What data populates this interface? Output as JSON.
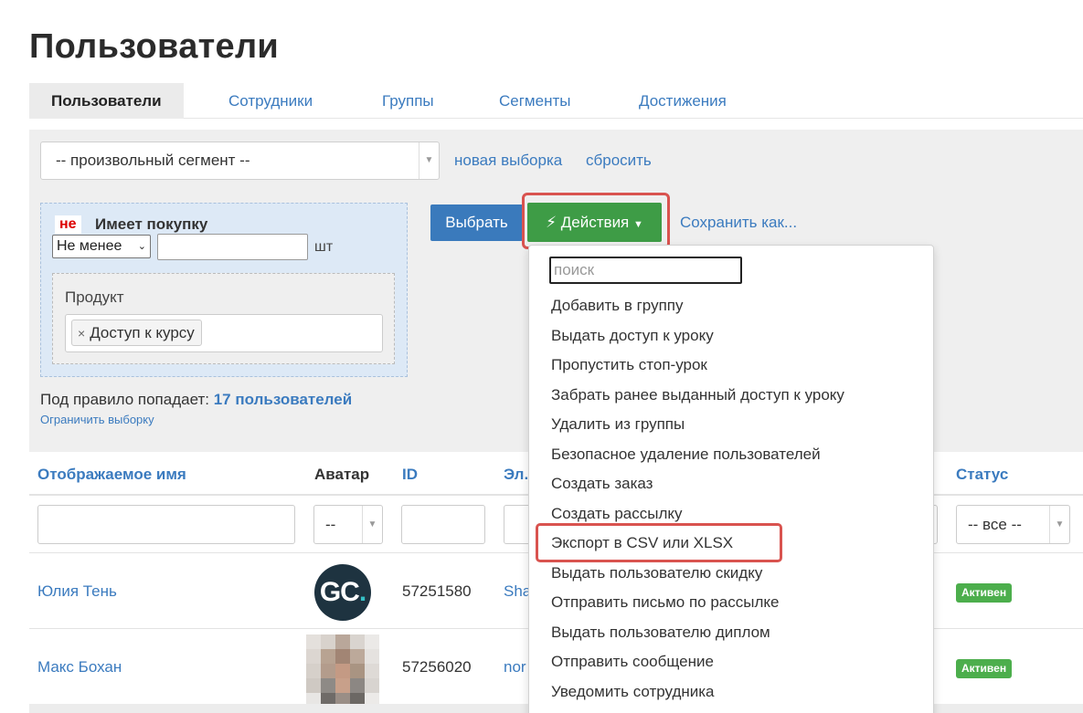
{
  "page": {
    "title": "Пользователи"
  },
  "tabs": [
    {
      "label": "Пользователи"
    },
    {
      "label": "Сотрудники"
    },
    {
      "label": "Группы"
    },
    {
      "label": "Сегменты"
    },
    {
      "label": "Достижения"
    }
  ],
  "segment": {
    "selected": "-- произвольный сегмент --",
    "new_label": "новая выборка",
    "reset_label": "сбросить"
  },
  "rule": {
    "negation": "не",
    "title": "Имеет покупку",
    "condition": "Не менее",
    "quantity_value": "",
    "unit": "шт",
    "product_label": "Продукт",
    "product_chip": "Доступ к курсу",
    "product_chip_remove": "×"
  },
  "summary": {
    "prefix": "Под правило попадает:",
    "count": "17 пользователей",
    "limit_link": "Ограничить выборку"
  },
  "buttons": {
    "choose": "Выбрать",
    "actions": "Действия",
    "save_as": "Сохранить как..."
  },
  "table": {
    "columns": {
      "display_name": "Отображаемое имя",
      "avatar": "Аватар",
      "id": "ID",
      "email": "Эл.",
      "status": "Статус"
    },
    "filters": {
      "avatar_select": "--",
      "status_select": "-- все --"
    },
    "rows": [
      {
        "name": "Юлия Тень",
        "avatar_text": "GC",
        "avatar_dot": ".",
        "id": "57251580",
        "email": "Sha",
        "status": "Активен"
      },
      {
        "name": "Макс Бохан",
        "id": "57256020",
        "email": "nor",
        "status": "Активен"
      }
    ]
  },
  "actions_menu": {
    "search_placeholder": "поиск",
    "items": [
      "Добавить в группу",
      "Выдать доступ к уроку",
      "Пропустить стоп-урок",
      "Забрать ранее выданный доступ к уроку",
      "Удалить из группы",
      "Безопасное удаление пользователей",
      "Создать заказ",
      "Создать рассылку",
      "Экспорт в CSV или XLSX",
      "Выдать пользователю скидку",
      "Отправить письмо по рассылке",
      "Выдать пользователю диплом",
      "Отправить сообщение",
      "Уведомить сотрудника"
    ],
    "highlighted_item": "Экспорт в CSV или XLSX"
  },
  "icons": {
    "actions_button": "lightning-icon",
    "actions_caret": "caret-down-icon",
    "select_arrow": "chevron-down-icon"
  },
  "colors": {
    "primary_blue": "#3a7abc",
    "link_blue": "#3b7bbf",
    "actions_green": "#3e9c46",
    "highlight_red": "#d9534f",
    "status_green": "#4cae4c",
    "negation_red": "#dd0000"
  }
}
